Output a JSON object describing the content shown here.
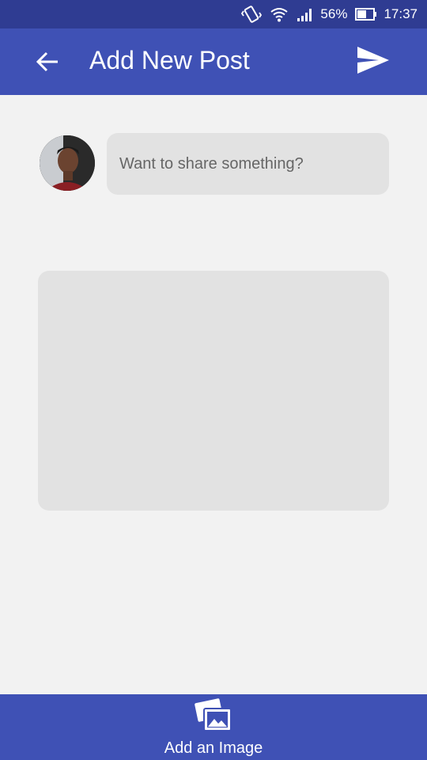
{
  "status_bar": {
    "battery_percent": "56%",
    "time": "17:37",
    "icons": [
      "vibrate-icon",
      "wifi-icon",
      "signal-icon",
      "battery-icon"
    ]
  },
  "app_bar": {
    "title": "Add New Post",
    "back_icon": "back-arrow-icon",
    "send_icon": "send-icon",
    "color": "#3f51b5"
  },
  "composer": {
    "placeholder": "Want to share something?"
  },
  "bottom_bar": {
    "add_image_label": "Add an Image",
    "icon": "image-icon"
  }
}
